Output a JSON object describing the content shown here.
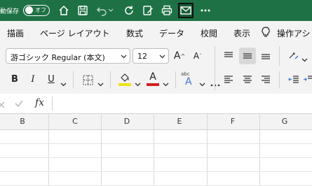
{
  "titlebar": {
    "autosave_label": "動保存",
    "autosave_state": "オフ",
    "icons": [
      "home-icon",
      "save-icon",
      "undo-icon",
      "redo-icon",
      "edit-document-icon",
      "print-icon",
      "mail-icon",
      "more-icon"
    ]
  },
  "menubar": {
    "items": [
      "描画",
      "ページ レイアウト",
      "数式",
      "データ",
      "校閲",
      "表示",
      "操作アシ"
    ]
  },
  "ribbon": {
    "font_name": "游ゴシック Regular (本文)",
    "font_size": "12",
    "increase_font": "A",
    "decrease_font": "A",
    "bold": "B",
    "italic": "I",
    "underline": "U",
    "font_color_letter": "A",
    "phonetic_small": "abc",
    "phonetic_large": "A",
    "fill_color": "#f0e21b",
    "font_color": "#d21f1f"
  },
  "formula_bar": {
    "function_label": "fx"
  },
  "sheet": {
    "columns": [
      "B",
      "C",
      "D",
      "E",
      "F",
      "G"
    ]
  }
}
